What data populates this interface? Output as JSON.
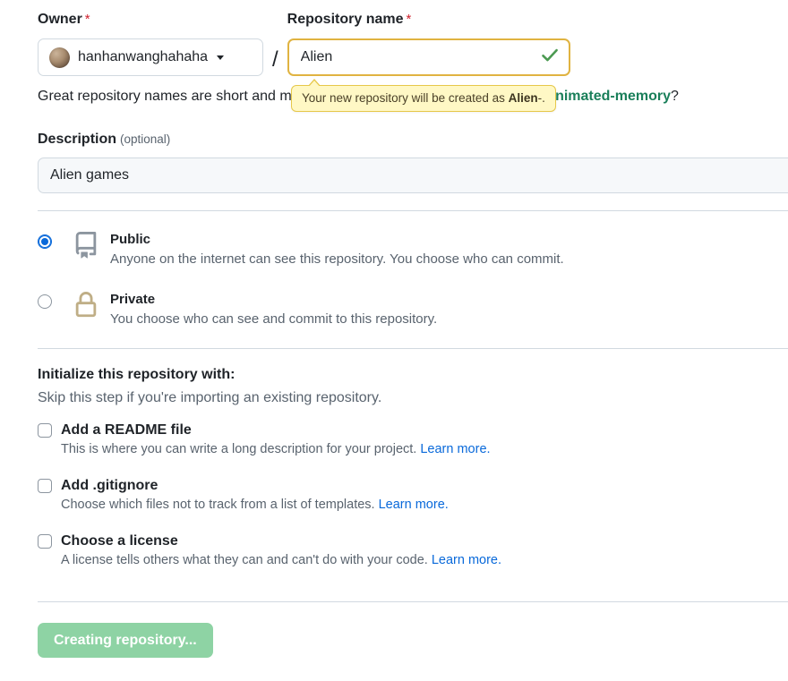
{
  "owner": {
    "label": "Owner",
    "required_marker": "*",
    "selected": "hanhanwanghahaha",
    "avatar_name": "user-avatar"
  },
  "separator": "/",
  "repo_name": {
    "label": "Repository name",
    "required_marker": "*",
    "value": "Alien",
    "placeholder": "",
    "valid_icon": "check-icon",
    "tooltip_prefix": "Your new repository will be created as ",
    "tooltip_strong": "Alien",
    "tooltip_suffix": "-."
  },
  "name_hint": {
    "lead": "Great repository names are short and memorable. Need inspiration? How about ",
    "suggestion": "animated-memory",
    "trail": "?"
  },
  "description": {
    "label": "Description",
    "optional": "(optional)",
    "value": "Alien games",
    "placeholder": ""
  },
  "visibility": {
    "options": [
      {
        "id": "public",
        "title": "Public",
        "description": "Anyone on the internet can see this repository. You choose who can commit.",
        "icon": "repo-icon",
        "selected": true
      },
      {
        "id": "private",
        "title": "Private",
        "description": "You choose who can see and commit to this repository.",
        "icon": "lock-icon",
        "selected": false
      }
    ]
  },
  "initialize": {
    "heading": "Initialize this repository with:",
    "subheading": "Skip this step if you're importing an existing repository.",
    "items": [
      {
        "id": "readme",
        "title": "Add a README file",
        "description": "This is where you can write a long description for your project.",
        "link_text": "Learn more.",
        "checked": false
      },
      {
        "id": "gitignore",
        "title": "Add .gitignore",
        "description": "Choose which files not to track from a list of templates.",
        "link_text": "Learn more.",
        "checked": false
      },
      {
        "id": "license",
        "title": "Choose a license",
        "description": "A license tells others what they can and can't do with your code.",
        "link_text": "Learn more.",
        "checked": false
      }
    ]
  },
  "submit": {
    "label": "Creating repository...",
    "state": "disabled"
  },
  "colors": {
    "accent_blue": "#0969da",
    "link_blue": "#0969da",
    "required_red": "#cf222e",
    "warning_border": "#e0b341",
    "tooltip_bg": "#fff8c5",
    "valid_green": "#4c9a52",
    "suggestion_green": "#1a7f5a",
    "lock_tan": "#bfae86",
    "repo_gray": "#8c959f",
    "button_green_muted": "#8ed3a4",
    "divider": "#d1d9e0"
  }
}
